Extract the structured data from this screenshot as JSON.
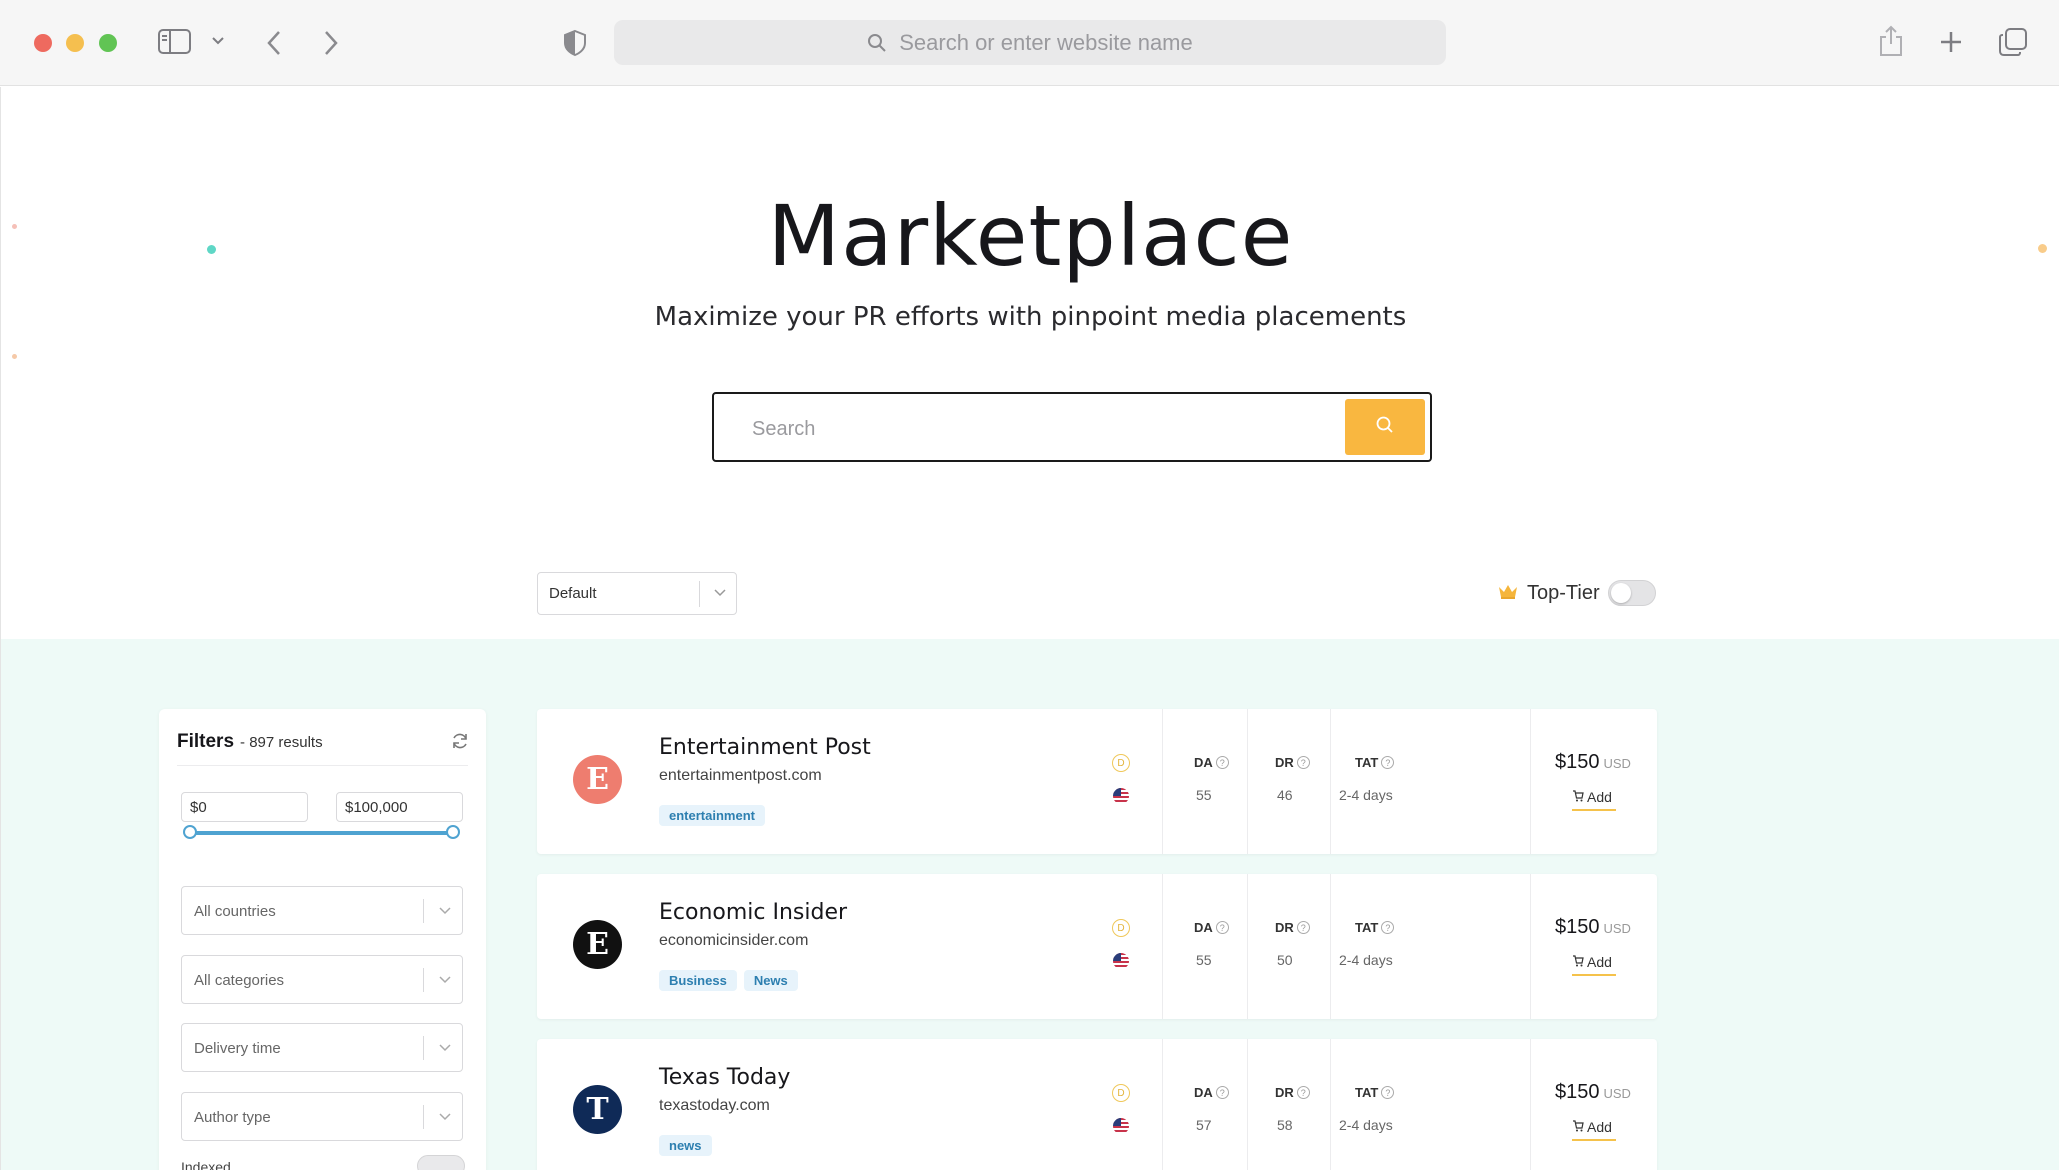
{
  "browser": {
    "url_placeholder": "Search or enter website name"
  },
  "hero": {
    "title": "Marketplace",
    "subtitle": "Maximize your PR efforts with pinpoint media placements",
    "search_placeholder": "Search"
  },
  "controls": {
    "sort_value": "Default",
    "top_tier_label": "Top-Tier",
    "top_tier_on": false
  },
  "filters": {
    "title": "Filters",
    "results": "- 897 results",
    "price_min": "$0",
    "price_max": "$100,000",
    "countries": "All countries",
    "categories": "All categories",
    "delivery": "Delivery time",
    "author": "Author type",
    "indexed": "Indexed"
  },
  "labels": {
    "da": "DA",
    "dr": "DR",
    "tat": "TAT",
    "currency": "USD",
    "add": "Add",
    "badge": "D"
  },
  "colors": {
    "accent": "#f9b740",
    "tag_text": "#2d7fb0",
    "mint_bg": "#eefaf7"
  },
  "listings": [
    {
      "initial": "E",
      "avatar_color": "#ee7d6f",
      "name": "Entertainment Post",
      "domain": "entertainmentpost.com",
      "tags": [
        "entertainment"
      ],
      "da": "55",
      "dr": "46",
      "tat": "2-4 days",
      "price": "$150"
    },
    {
      "initial": "E",
      "avatar_color": "#111111",
      "name": "Economic Insider",
      "domain": "economicinsider.com",
      "tags": [
        "Business",
        "News"
      ],
      "da": "55",
      "dr": "50",
      "tat": "2-4 days",
      "price": "$150"
    },
    {
      "initial": "T",
      "avatar_color": "#0f2a57",
      "name": "Texas Today",
      "domain": "texastoday.com",
      "tags": [
        "news"
      ],
      "da": "57",
      "dr": "58",
      "tat": "2-4 days",
      "price": "$150"
    }
  ]
}
